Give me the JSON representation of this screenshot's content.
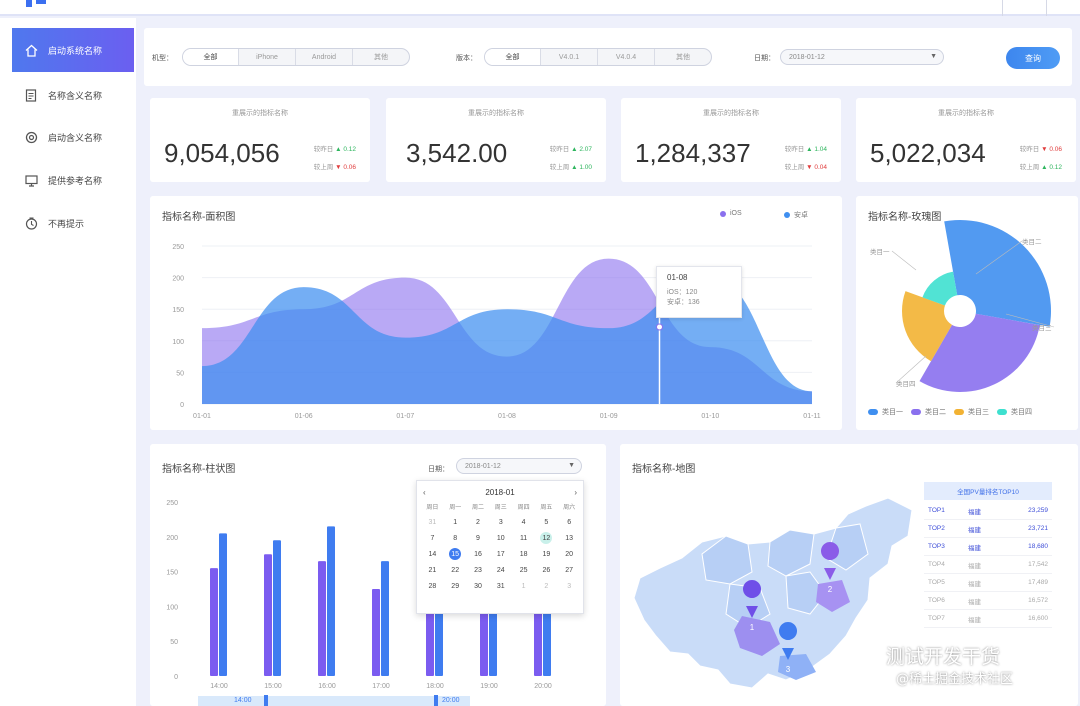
{
  "colors": {
    "accent": "#4f78ee",
    "purple": "#8a70ee",
    "blue": "#4a8ff2",
    "up": "#2db55d",
    "down": "#e03c3c"
  },
  "sidebar": {
    "items": [
      {
        "label": "启动系统名称",
        "icon": "home-icon",
        "active": true
      },
      {
        "label": "名称含义名称",
        "icon": "document-icon"
      },
      {
        "label": "启动含义名称",
        "icon": "settings-icon"
      },
      {
        "label": "提供参考名称",
        "icon": "monitor-icon"
      },
      {
        "label": "不再提示",
        "icon": "clock-icon"
      }
    ]
  },
  "filters": {
    "platform": {
      "label": "机型：",
      "options": [
        "全部",
        "iPhone",
        "Android",
        "其他"
      ]
    },
    "version": {
      "label": "版本：",
      "options": [
        "全部",
        "V4.0.1",
        "V4.0.4",
        "其他"
      ]
    },
    "date": {
      "label": "日期：",
      "value": "2018-01-12"
    },
    "query_label": "查询"
  },
  "kpis": [
    {
      "title": "重展示的指标名称",
      "value": "9,054,056",
      "c1_label": "较昨日",
      "c1_value": "▲ 0.12",
      "c1_dir": "up",
      "c2_label": "较上周",
      "c2_value": "▼ 0.06",
      "c2_dir": "down"
    },
    {
      "title": "重展示的指标名称",
      "value": "3,542.00",
      "c1_label": "较昨日",
      "c1_value": "▲ 2.07",
      "c1_dir": "up",
      "c2_label": "较上周",
      "c2_value": "▲ 1.00",
      "c2_dir": "up"
    },
    {
      "title": "重展示的指标名称",
      "value": "1,284,337",
      "c1_label": "较昨日",
      "c1_value": "▲ 1.04",
      "c1_dir": "up",
      "c2_label": "较上周",
      "c2_value": "▼ 0.04",
      "c2_dir": "down"
    },
    {
      "title": "重展示的指标名称",
      "value": "5,022,034",
      "c1_label": "较昨日",
      "c1_value": "▼ 0.06",
      "c1_dir": "down",
      "c2_label": "较上周",
      "c2_value": "▲ 0.12",
      "c2_dir": "up"
    }
  ],
  "area_panel": {
    "title": "指标名称-面积图",
    "legend": [
      {
        "name": "iOS",
        "color": "#8a70ee"
      },
      {
        "name": "安卓",
        "color": "#3f8ff0"
      }
    ],
    "tooltip": {
      "date": "01-08",
      "line1": "iOS：120",
      "line2": "安卓：136"
    }
  },
  "rose_panel": {
    "title": "指标名称-玫瑰图",
    "labels": [
      "类目一",
      "类目二",
      "类目三",
      "类目四"
    ],
    "legend": [
      {
        "name": "类目一",
        "color": "#3f8ff0"
      },
      {
        "name": "类目二",
        "color": "#8a70ee"
      },
      {
        "name": "类目三",
        "color": "#f2b233"
      },
      {
        "name": "类目四",
        "color": "#3ee0cf"
      }
    ]
  },
  "bar_panel": {
    "title": "指标名称-柱状图",
    "date_label": "日期：",
    "date_value": "2018-01-12",
    "calendar": {
      "month": "2018-01",
      "weekdays": [
        "周日",
        "周一",
        "周二",
        "周三",
        "周四",
        "周五",
        "周六"
      ],
      "rows": [
        [
          "31",
          "1",
          "2",
          "3",
          "4",
          "5",
          "6"
        ],
        [
          "7",
          "8",
          "9",
          "10",
          "11",
          "12",
          "13"
        ],
        [
          "14",
          "15",
          "16",
          "17",
          "18",
          "19",
          "20"
        ],
        [
          "21",
          "22",
          "23",
          "24",
          "25",
          "26",
          "27"
        ],
        [
          "28",
          "29",
          "30",
          "31",
          "1",
          "2",
          "3"
        ]
      ],
      "selected": "15",
      "today": "12"
    },
    "slider": {
      "start_label": "14:00",
      "end_label": "20:00"
    }
  },
  "map_panel": {
    "title": "指标名称-地图",
    "table_title": "全国PV量排名TOP10",
    "rows": [
      {
        "rank": "TOP1",
        "name": "福建",
        "value": "23,259",
        "highlight": true
      },
      {
        "rank": "TOP2",
        "name": "福建",
        "value": "23,721",
        "highlight": true
      },
      {
        "rank": "TOP3",
        "name": "福建",
        "value": "18,680",
        "highlight": true
      },
      {
        "rank": "TOP4",
        "name": "福建",
        "value": "17,542"
      },
      {
        "rank": "TOP5",
        "name": "福建",
        "value": "17,489"
      },
      {
        "rank": "TOP6",
        "name": "福建",
        "value": "16,572"
      },
      {
        "rank": "TOP7",
        "name": "福建",
        "value": "16,600"
      }
    ],
    "pins": [
      "1",
      "2",
      "3"
    ]
  },
  "watermark": {
    "line1": "测试开发干货",
    "line2": "@稀土掘金技术社区"
  },
  "chart_data": [
    {
      "type": "area",
      "title": "指标名称-面积图",
      "x": [
        "01-01",
        "01-06",
        "01-07",
        "01-08",
        "01-09",
        "01-10",
        "01-11"
      ],
      "ylim": [
        0,
        250
      ],
      "yticks": [
        0,
        50,
        100,
        150,
        200,
        250
      ],
      "grid": true,
      "legend_position": "top-right",
      "series": [
        {
          "name": "iOS",
          "color": "#8a70ee",
          "values": [
            120,
            150,
            200,
            75,
            230,
            90,
            20
          ]
        },
        {
          "name": "安卓",
          "color": "#3f8ff0",
          "values": [
            60,
            185,
            105,
            150,
            120,
            200,
            20
          ]
        }
      ]
    },
    {
      "type": "pie",
      "title": "指标名称-玫瑰图",
      "variant": "rose",
      "categories": [
        "类目一",
        "类目二",
        "类目三",
        "类目四"
      ],
      "values": [
        75,
        65,
        42,
        24
      ],
      "angles_deg": [
        110,
        110,
        80,
        60
      ]
    },
    {
      "type": "bar",
      "title": "指标名称-柱状图",
      "categories": [
        "14:00",
        "15:00",
        "16:00",
        "17:00",
        "18:00",
        "19:00",
        "20:00"
      ],
      "ylim": [
        0,
        250
      ],
      "yticks": [
        0,
        50,
        100,
        150,
        200,
        250
      ],
      "series": [
        {
          "color": "#7b5cf0",
          "values": [
            155,
            175,
            165,
            125,
            110,
            180,
            175
          ]
        },
        {
          "color": "#3f7cf0",
          "values": [
            205,
            195,
            215,
            165,
            195,
            195,
            205
          ]
        }
      ]
    }
  ]
}
